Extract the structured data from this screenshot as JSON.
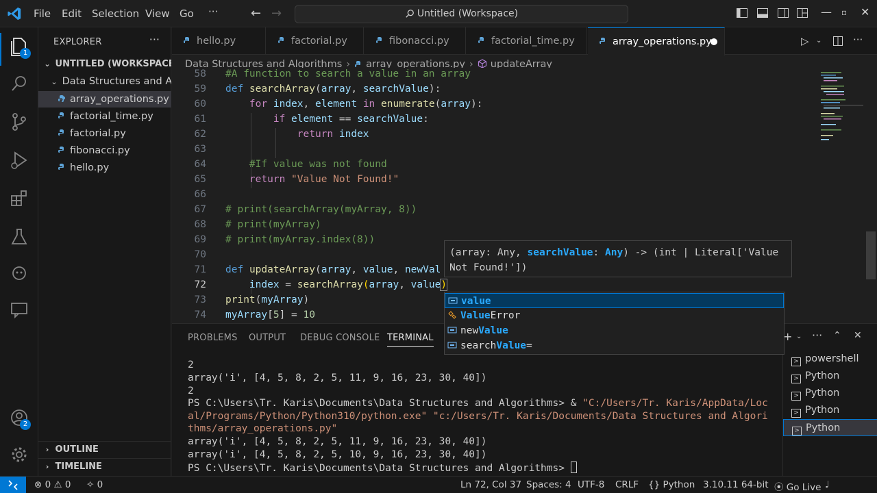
{
  "titlebar": {
    "menu": [
      "File",
      "Edit",
      "Selection",
      "View",
      "Go",
      "···"
    ],
    "search_text": "Untitled (Workspace)"
  },
  "activity": {
    "explorer_badge": "1",
    "accounts_badge": "2"
  },
  "sidebar": {
    "title": "EXPLORER",
    "more": "···",
    "workspace": "UNTITLED (WORKSPACE)",
    "folder": "Data Structures and Algorithms",
    "files": [
      "array_operations.py",
      "factorial_time.py",
      "factorial.py",
      "fibonacci.py",
      "hello.py"
    ],
    "outline": "OUTLINE",
    "timeline": "TIMELINE"
  },
  "tabs": [
    "hello.py",
    "factorial.py",
    "fibonacci.py",
    "factorial_time.py",
    "array_operations.py"
  ],
  "breadcrumb": {
    "folder": "Data Structures and Algorithms",
    "file": "array_operations.py",
    "symbol": "updateArray"
  },
  "editor": {
    "line_numbers": [
      "58",
      "59",
      "60",
      "61",
      "62",
      "63",
      "64",
      "65",
      "66",
      "67",
      "68",
      "69",
      "70",
      "71",
      "72",
      "73",
      "74"
    ],
    "lines": {
      "l58": "#A function to search a value in an array",
      "l59_def": "def",
      "l59_fn": "searchArray",
      "l59_p1": "array",
      "l59_p2": "searchValue",
      "l60_for": "for",
      "l60_v1": "index",
      "l60_v2": "element",
      "l60_in": "in",
      "l60_fn": "enumerate",
      "l60_arg": "array",
      "l61_if": "if",
      "l61_v1": "element",
      "l61_op": " == ",
      "l61_v2": "searchValue",
      "l62_ret": "return",
      "l62_v": "index",
      "l64": "#If value was not found",
      "l65_ret": "return",
      "l65_str": "\"Value Not Found!\"",
      "l67": "# print(searchArray(myArray, 8))",
      "l68": "# print(myArray)",
      "l69": "# print(myArray.index(8))",
      "l71_def": "def",
      "l71_fn": "updateArray",
      "l71_p1": "array",
      "l71_p2": "value",
      "l71_p3": "newVal",
      "l72_v": "index",
      "l72_eq": " = ",
      "l72_fn": "searchArray",
      "l72_a1": "array",
      "l72_a2": "value",
      "l73_fn": "print",
      "l73_arg": "myArray",
      "l74_v": "myArray",
      "l74_idx": "5",
      "l74_eq": " = ",
      "l74_num": "10"
    }
  },
  "hover": {
    "line1_a": "(array: Any, ",
    "line1_b": "searchValue",
    "line1_c": ": ",
    "line1_d": "Any",
    "line1_e": ") -> (int | Literal['Value",
    "line2": "Not Found!'])"
  },
  "suggest": [
    {
      "match": "value",
      "rest": ""
    },
    {
      "match": "Value",
      "rest": "Error"
    },
    {
      "prefix": "new",
      "match": "Value",
      "rest": ""
    },
    {
      "prefix": "search",
      "match": "Value",
      "rest": "="
    }
  ],
  "panel": {
    "tabs": [
      "PROBLEMS",
      "OUTPUT",
      "DEBUG CONSOLE",
      "TERMINAL"
    ],
    "terminal_lines": [
      "2",
      "array('i', [4, 5, 8, 2, 5, 11, 9, 16, 23, 30, 40])",
      "2"
    ],
    "ps_prompt": "PS C:\\Users\\Tr. Karis\\Documents\\Data Structures and Algorithms> & ",
    "ps_path1": "\"C:/Users/Tr. Karis/AppData/Loc",
    "ps_path2": "al/Programs/Python/Python310/python.exe\" \"c:/Users/Tr. Karis/Documents/Data Structures and Algori",
    "ps_path3": "thms/array_operations.py\"",
    "out1": "array('i', [4, 5, 8, 2, 5, 11, 9, 16, 23, 30, 40])",
    "out2": "array('i', [4, 5, 8, 2, 5, 10, 9, 16, 23, 30, 40])",
    "final_prompt": "PS C:\\Users\\Tr. Karis\\Documents\\Data Structures and Algorithms> ",
    "terminals": [
      "powershell",
      "Python",
      "Python",
      "Python",
      "Python"
    ]
  },
  "statusbar": {
    "errors": "0",
    "warnings": "0",
    "ports": "0",
    "position": "Ln 72, Col 37",
    "spaces": "Spaces: 4",
    "encoding": "UTF-8",
    "eol": "CRLF",
    "language": "Python",
    "interpreter": "3.10.11 64-bit",
    "golive": "Go Live"
  },
  "colors": {
    "accent": "#0078d4",
    "background": "#1f1f1f",
    "keyword": "#569cd6",
    "function": "#dcdcaa",
    "comment": "#6a9955",
    "string": "#ce9178"
  }
}
